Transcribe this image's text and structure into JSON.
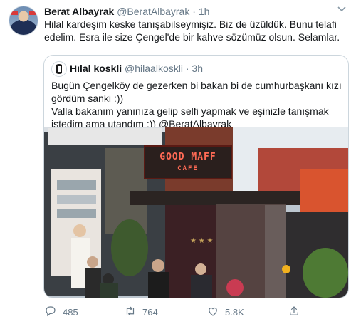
{
  "tweet": {
    "name": "Berat Albayrak",
    "handle": "@BeratAlbayrak",
    "separator": "·",
    "time": "1h",
    "text": "Hilal kardeşim keske tanışabilseymişiz. Biz de üzüldük. Bunu telafi edelim. Esra ile size Çengel'de bir kahve sözümüz olsun. Selamlar."
  },
  "quote": {
    "name": "Hılal koskli",
    "handle": "@hilaalkoskli",
    "separator": "·",
    "time": "3h",
    "line1": "Bugün Çengelköy de gezerken bi bakan bi de cumhurbaşkanı kızı gördüm sanki :))",
    "line2": "Valla bakanım yanınıza gelip selfi yapmak ve eşinizle tanışmak istedim ama utandım :)) @BeratAlbayrak",
    "photo": {
      "sign_line1": "GOOD MAFF",
      "sign_line2": "CAFE"
    }
  },
  "actions": {
    "replies": "485",
    "retweets": "764",
    "likes": "5.8K"
  },
  "icons": {
    "reply": "reply-icon",
    "retweet": "retweet-icon",
    "like": "heart-icon",
    "share": "share-icon",
    "menu": "chevron-down-icon"
  },
  "colors": {
    "text": "#14171a",
    "muted": "#657786",
    "border": "#ccd6dd"
  }
}
